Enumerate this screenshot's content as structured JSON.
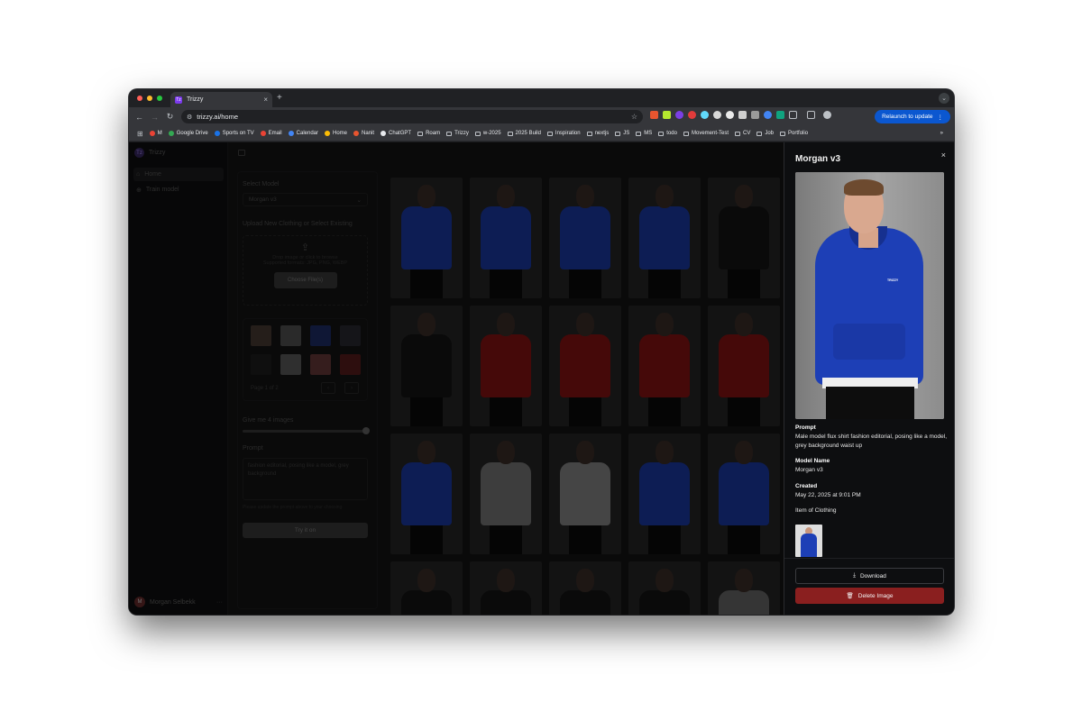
{
  "browser": {
    "tab_title": "Trizzy",
    "tab_favicon": "Tz",
    "new_tab": "+",
    "url": "trizzy.ai/home",
    "relaunch": "Relaunch to update",
    "bookmarks": [
      "M",
      "Google Drive",
      "Sports on TV",
      "Email",
      "Calendar",
      "Home",
      "Nanit",
      "ChatGPT",
      "Roam",
      "Trizzy",
      "w-2025",
      "2025 Build",
      "Inspiration",
      "nextjs",
      "JS",
      "MS",
      "todo",
      "Movement-Test",
      "CV",
      "Job",
      "Portfolio"
    ],
    "more_bookmarks": "»"
  },
  "sidebar": {
    "brand": "Trizzy",
    "items": [
      {
        "label": "Home",
        "icon": "home-icon"
      },
      {
        "label": "Train model",
        "icon": "plus-circle-icon"
      }
    ],
    "user": {
      "name": "Morgan Selbekk",
      "initial": "M",
      "more": "···"
    }
  },
  "form": {
    "select_model_label": "Select Model",
    "select_model_value": "Morgan v3",
    "upload_label": "Upload New Clothing or Select Existing",
    "upload_hint": "Drop image or click to browse",
    "upload_formats": "Supported formats: JPG, PNG, WEBP",
    "choose_button": "Choose File(s)",
    "pager_text": "Page 1 of 2",
    "pager_prev": "‹",
    "pager_next": "›",
    "count_label": "Give me 4 images",
    "count_value": 4,
    "prompt_label": "Prompt",
    "prompt_value": "fashion editorial, posing like a model, grey background",
    "prompt_hint": "Please update the prompt above to your choosing",
    "submit": "Try it on"
  },
  "detail": {
    "title": "Morgan v3",
    "close": "×",
    "hero_logo_text": "TRIZZY",
    "prompt_label": "Prompt",
    "prompt_value": "Male model flux shirt fashion editorial, posing like a model, grey background waist up",
    "model_name_label": "Model Name",
    "model_name_value": "Morgan v3",
    "created_label": "Created",
    "created_value": "May 22, 2025 at 9:01 PM",
    "clothing_label": "Item of Clothing",
    "download": "Download",
    "delete": "Delete Image"
  },
  "colors": {
    "accent_blue": "#1d3fb6",
    "danger": "#8a1f1f",
    "relaunch": "#0b57d0"
  }
}
